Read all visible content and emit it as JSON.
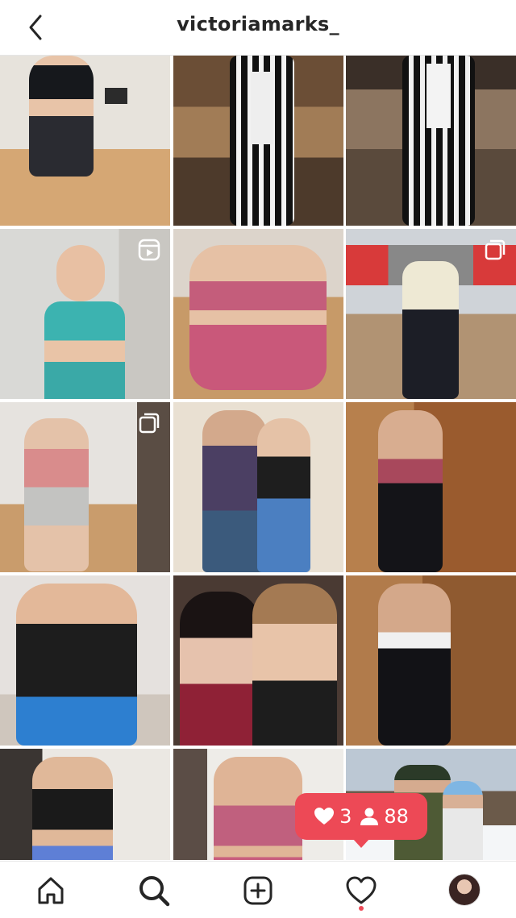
{
  "header": {
    "username": "victoriamarks_"
  },
  "posts": [
    {
      "index": 1
    },
    {
      "index": 2
    },
    {
      "index": 3
    },
    {
      "index": 4,
      "badge": "reel-icon"
    },
    {
      "index": 5
    },
    {
      "index": 6,
      "badge": "carousel-icon"
    },
    {
      "index": 7,
      "badge": "carousel-icon"
    },
    {
      "index": 8
    },
    {
      "index": 9
    },
    {
      "index": 10
    },
    {
      "index": 11
    },
    {
      "index": 12
    },
    {
      "index": 13
    },
    {
      "index": 14
    },
    {
      "index": 15
    }
  ],
  "notification": {
    "likes": "3",
    "followers": "88"
  },
  "nav": {
    "items": [
      "home-icon",
      "search-icon",
      "new-post-icon",
      "activity-icon",
      "profile-avatar"
    ],
    "accent": "#ed4956"
  }
}
